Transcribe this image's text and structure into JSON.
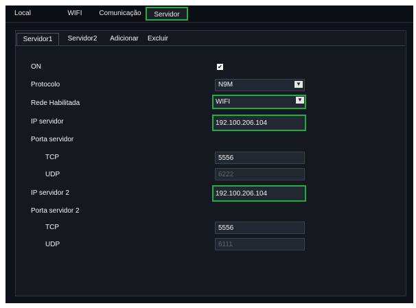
{
  "top_tabs": [
    {
      "label": "Local"
    },
    {
      "label": "WIFI"
    },
    {
      "label": "Comunicação"
    },
    {
      "label": "Servidor"
    }
  ],
  "sub_tabs": [
    {
      "label": "Servidor1"
    },
    {
      "label": "Servidor2"
    },
    {
      "label": "Adicionar"
    },
    {
      "label": "Excluir"
    }
  ],
  "form": {
    "on_label": "ON",
    "on_checked": true,
    "on_mark": "✔",
    "protocolo_label": "Protocolo",
    "protocolo_value": "N9M",
    "rede_label": "Rede Habilitada",
    "rede_value": "WIFI",
    "ip1_label": "IP servidor",
    "ip1_value": "192.100.206.104",
    "porta1_label": "Porta servidor",
    "tcp1_label": "TCP",
    "tcp1_value": "5556",
    "udp1_label": "UDP",
    "udp1_value": "6222",
    "ip2_label": "IP servidor 2",
    "ip2_value": "192.100.206.104",
    "porta2_label": "Porta servidor 2",
    "tcp2_label": "TCP",
    "tcp2_value": "5556",
    "udp2_label": "UDP",
    "udp2_value": "6111",
    "dropdown_arrow": "▼"
  },
  "colors": {
    "highlight": "#1fae43",
    "background": "#0f1319"
  }
}
